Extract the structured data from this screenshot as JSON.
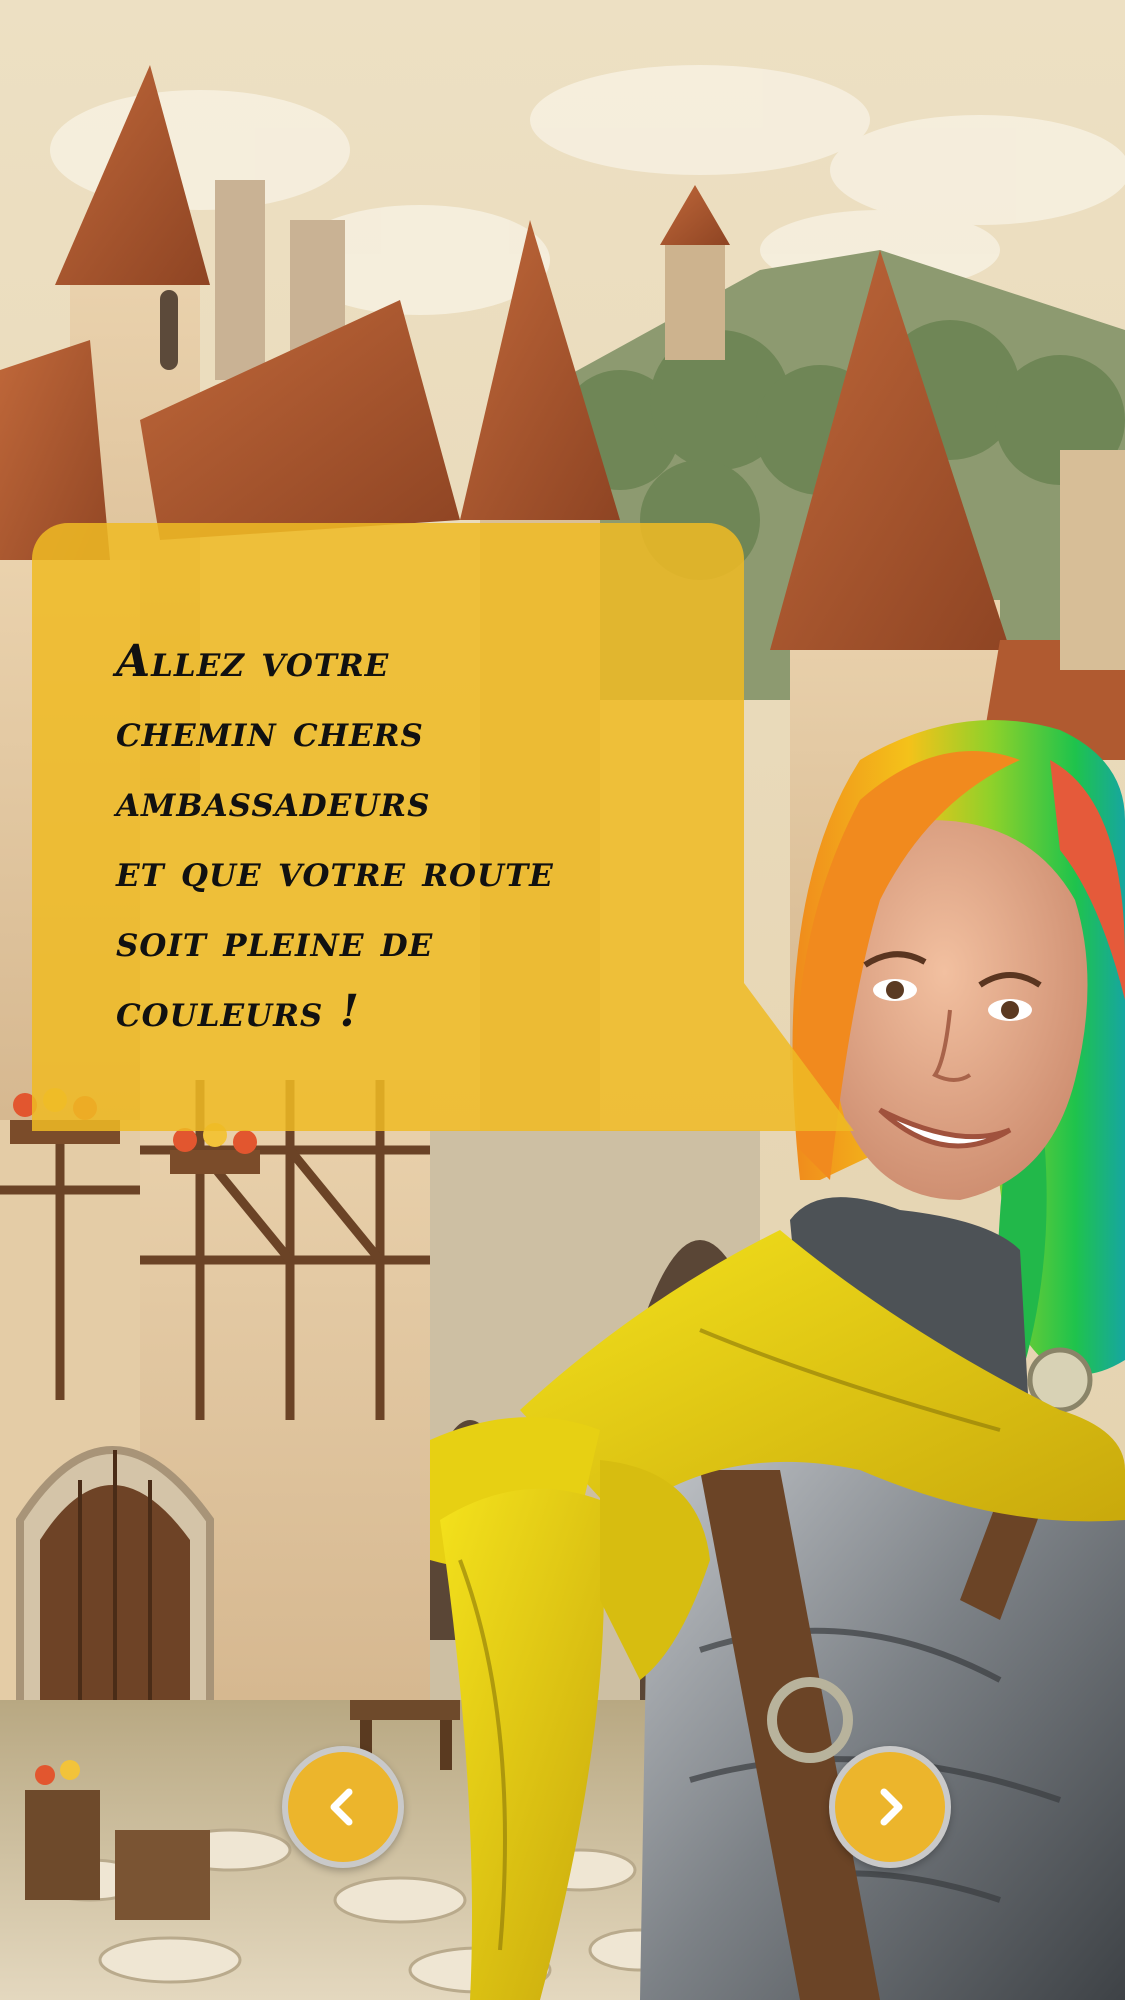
{
  "dialogue": {
    "text": "Allez votre\nchemin chers\nambassadeurs\net que votre route\nsoit pleine de\ncouleurs !"
  },
  "colors": {
    "bubble": "#efba24",
    "button_fill": "#ecb52c",
    "button_ring": "#c9c9c9",
    "chevron": "#ffffff"
  },
  "icons": {
    "previous": "chevron-left-icon",
    "next": "chevron-right-icon"
  }
}
